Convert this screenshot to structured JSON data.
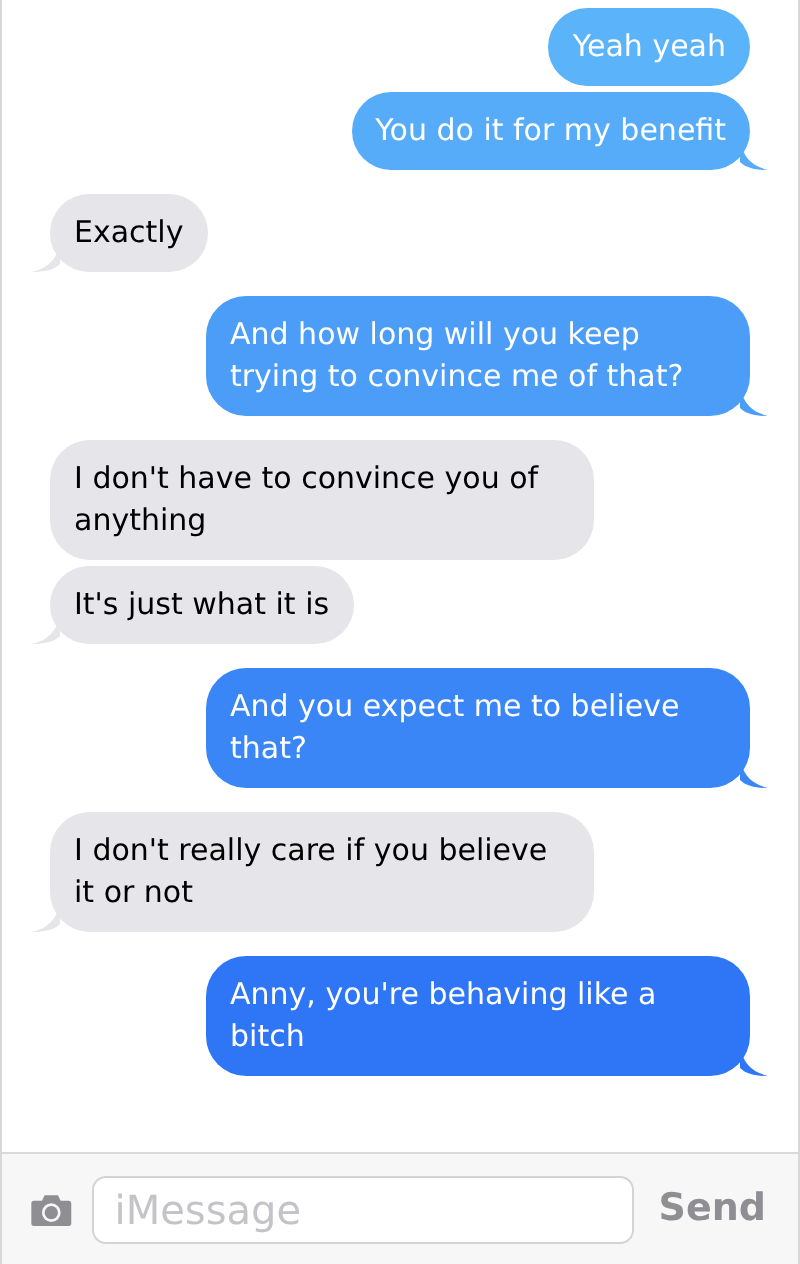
{
  "messages": [
    {
      "kind": "sent",
      "text": "Yeah yeah"
    },
    {
      "kind": "sent",
      "text": "You do it for my benefit"
    },
    {
      "kind": "received",
      "text": "Exactly"
    },
    {
      "kind": "sent",
      "text": "And how long will you keep trying to convince me of that?"
    },
    {
      "kind": "received",
      "text": "I don't have to convince you of anything"
    },
    {
      "kind": "received",
      "text": "It's just what it is"
    },
    {
      "kind": "sent",
      "text": "And you expect me to believe that?"
    },
    {
      "kind": "received",
      "text": "I don't really care if you believe it or not"
    },
    {
      "kind": "sent",
      "text": "Anny, you're behaving like a bitch"
    }
  ],
  "composer": {
    "placeholder": "iMessage",
    "send_label": "Send"
  }
}
